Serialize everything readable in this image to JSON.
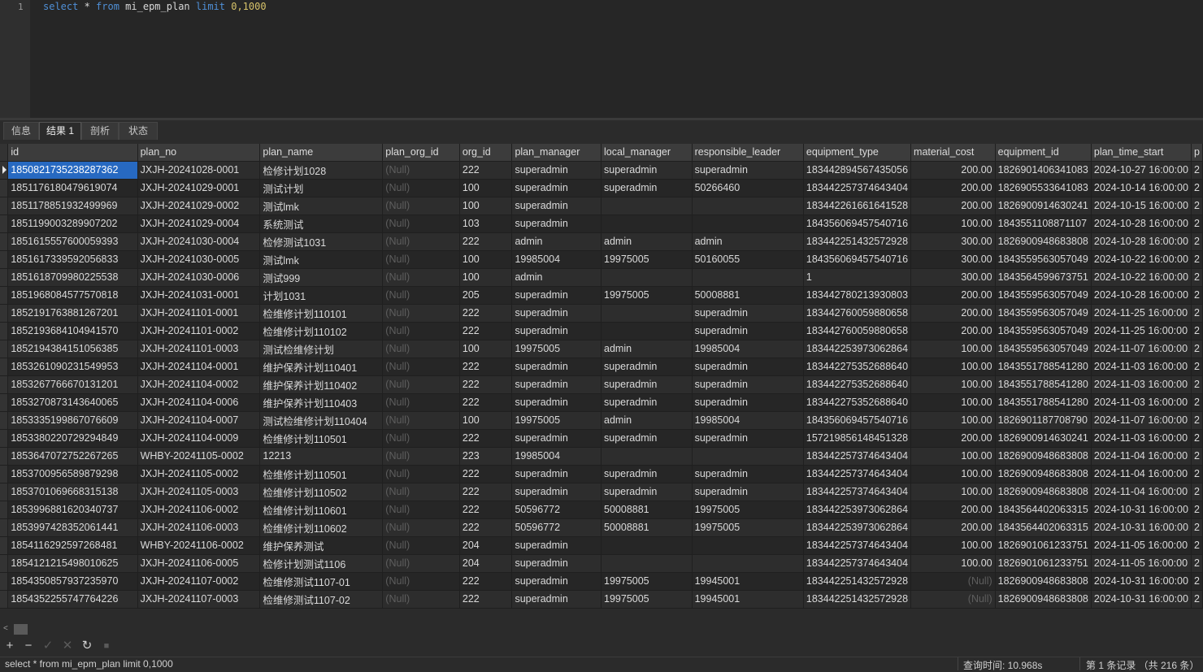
{
  "editor": {
    "line_number": "1",
    "tokens": {
      "select": "select",
      "star": " * ",
      "from": "from",
      "table": " mi_epm_plan ",
      "limit": "limit",
      "range": " 0,1000"
    }
  },
  "tabs": [
    {
      "label": "信息"
    },
    {
      "label": "结果 1"
    },
    {
      "label": "剖析"
    },
    {
      "label": "状态"
    }
  ],
  "grid": {
    "columns": [
      "id",
      "plan_no",
      "plan_name",
      "plan_org_id",
      "org_id",
      "plan_manager",
      "local_manager",
      "responsible_leader",
      "equipment_type",
      "material_cost",
      "equipment_id",
      "plan_time_start",
      "p"
    ],
    "rows": [
      [
        "1850821735238287362",
        "JXJH-20241028-0001",
        "检修计划1028",
        "(Null)",
        "222",
        "superadmin",
        "superadmin",
        "superadmin",
        "183442894567435056",
        "200.00",
        "1826901406341083",
        "2024-10-27 16:00:00",
        "2"
      ],
      [
        "1851176180479619074",
        "JXJH-20241029-0001",
        "测试计划",
        "(Null)",
        "100",
        "superadmin",
        "superadmin",
        "50266460",
        "183442257374643404",
        "200.00",
        "1826905533641083",
        "2024-10-14 16:00:00",
        "2"
      ],
      [
        "1851178851932499969",
        "JXJH-20241029-0002",
        "测试lmk",
        "(Null)",
        "100",
        "superadmin",
        "",
        "",
        "183442261661641528",
        "200.00",
        "1826900914630241",
        "2024-10-15 16:00:00",
        "2"
      ],
      [
        "1851199003289907202",
        "JXJH-20241029-0004",
        "系统测试",
        "(Null)",
        "103",
        "superadmin",
        "",
        "",
        "184356069457540716",
        "100.00",
        "1843551108871107",
        "2024-10-28 16:00:00",
        "2"
      ],
      [
        "1851615557600059393",
        "JXJH-20241030-0004",
        "检修测试1031",
        "(Null)",
        "222",
        "admin",
        "admin",
        "admin",
        "183442251432572928",
        "300.00",
        "1826900948683808",
        "2024-10-28 16:00:00",
        "2"
      ],
      [
        "1851617339592056833",
        "JXJH-20241030-0005",
        "测试lmk",
        "(Null)",
        "100",
        "19985004",
        "19975005",
        "50160055",
        "184356069457540716",
        "300.00",
        "1843559563057049",
        "2024-10-22 16:00:00",
        "2"
      ],
      [
        "1851618709980225538",
        "JXJH-20241030-0006",
        "测试999",
        "(Null)",
        "100",
        "admin",
        "",
        "",
        "1",
        "300.00",
        "1843564599673751",
        "2024-10-22 16:00:00",
        "2"
      ],
      [
        "1851968084577570818",
        "JXJH-20241031-0001",
        "计划1031",
        "(Null)",
        "205",
        "superadmin",
        "19975005",
        "50008881",
        "183442780213930803",
        "200.00",
        "1843559563057049",
        "2024-10-28 16:00:00",
        "2"
      ],
      [
        "1852191763881267201",
        "JXJH-20241101-0001",
        "检维修计划110101",
        "(Null)",
        "222",
        "superadmin",
        "",
        "superadmin",
        "183442760059880658",
        "200.00",
        "1843559563057049",
        "2024-11-25 16:00:00",
        "2"
      ],
      [
        "1852193684104941570",
        "JXJH-20241101-0002",
        "检维修计划110102",
        "(Null)",
        "222",
        "superadmin",
        "",
        "superadmin",
        "183442760059880658",
        "200.00",
        "1843559563057049",
        "2024-11-25 16:00:00",
        "2"
      ],
      [
        "1852194384151056385",
        "JXJH-20241101-0003",
        "测试检维修计划",
        "(Null)",
        "100",
        "19975005",
        "admin",
        "19985004",
        "183442253973062864",
        "100.00",
        "1843559563057049",
        "2024-11-07 16:00:00",
        "2"
      ],
      [
        "1853261090231549953",
        "JXJH-20241104-0001",
        "维护保养计划110401",
        "(Null)",
        "222",
        "superadmin",
        "superadmin",
        "superadmin",
        "183442275352688640",
        "100.00",
        "1843551788541280",
        "2024-11-03 16:00:00",
        "2"
      ],
      [
        "1853267766670131201",
        "JXJH-20241104-0002",
        "维护保养计划110402",
        "(Null)",
        "222",
        "superadmin",
        "superadmin",
        "superadmin",
        "183442275352688640",
        "100.00",
        "1843551788541280",
        "2024-11-03 16:00:00",
        "2"
      ],
      [
        "1853270873143640065",
        "JXJH-20241104-0006",
        "维护保养计划110403",
        "(Null)",
        "222",
        "superadmin",
        "superadmin",
        "superadmin",
        "183442275352688640",
        "100.00",
        "1843551788541280",
        "2024-11-03 16:00:00",
        "2"
      ],
      [
        "1853335199867076609",
        "JXJH-20241104-0007",
        "测试检维修计划110404",
        "(Null)",
        "100",
        "19975005",
        "admin",
        "19985004",
        "184356069457540716",
        "100.00",
        "1826901187708790",
        "2024-11-07 16:00:00",
        "2"
      ],
      [
        "1853380220729294849",
        "JXJH-20241104-0009",
        "检维修计划110501",
        "(Null)",
        "222",
        "superadmin",
        "superadmin",
        "superadmin",
        "157219856148451328",
        "200.00",
        "1826900914630241",
        "2024-11-03 16:00:00",
        "2"
      ],
      [
        "1853647072752267265",
        "WHBY-20241105-0002",
        "12213",
        "(Null)",
        "223",
        "19985004",
        "",
        "",
        "183442257374643404",
        "100.00",
        "1826900948683808",
        "2024-11-04 16:00:00",
        "2"
      ],
      [
        "1853700956589879298",
        "JXJH-20241105-0002",
        "检维修计划110501",
        "(Null)",
        "222",
        "superadmin",
        "superadmin",
        "superadmin",
        "183442257374643404",
        "100.00",
        "1826900948683808",
        "2024-11-04 16:00:00",
        "2"
      ],
      [
        "1853701069668315138",
        "JXJH-20241105-0003",
        "检维修计划110502",
        "(Null)",
        "222",
        "superadmin",
        "superadmin",
        "superadmin",
        "183442257374643404",
        "100.00",
        "1826900948683808",
        "2024-11-04 16:00:00",
        "2"
      ],
      [
        "1853996881620340737",
        "JXJH-20241106-0002",
        "检维修计划110601",
        "(Null)",
        "222",
        "50596772",
        "50008881",
        "19975005",
        "183442253973062864",
        "200.00",
        "1843564402063315",
        "2024-10-31 16:00:00",
        "2"
      ],
      [
        "1853997428352061441",
        "JXJH-20241106-0003",
        "检维修计划110602",
        "(Null)",
        "222",
        "50596772",
        "50008881",
        "19975005",
        "183442253973062864",
        "200.00",
        "1843564402063315",
        "2024-10-31 16:00:00",
        "2"
      ],
      [
        "1854116292597268481",
        "WHBY-20241106-0002",
        "维护保养测试",
        "(Null)",
        "204",
        "superadmin",
        "",
        "",
        "183442257374643404",
        "100.00",
        "1826901061233751",
        "2024-11-05 16:00:00",
        "2"
      ],
      [
        "1854121215498010625",
        "JXJH-20241106-0005",
        "检修计划测试1106",
        "(Null)",
        "204",
        "superadmin",
        "",
        "",
        "183442257374643404",
        "100.00",
        "1826901061233751",
        "2024-11-05 16:00:00",
        "2"
      ],
      [
        "1854350857937235970",
        "JXJH-20241107-0002",
        "检维修测试1107-01",
        "(Null)",
        "222",
        "superadmin",
        "19975005",
        "19945001",
        "183442251432572928",
        "(Null)",
        "1826900948683808",
        "2024-10-31 16:00:00",
        "2"
      ],
      [
        "1854352255747764226",
        "JXJH-20241107-0003",
        "检维修测试1107-02",
        "(Null)",
        "222",
        "superadmin",
        "19975005",
        "19945001",
        "183442251432572928",
        "(Null)",
        "1826900948683808",
        "2024-10-31 16:00:00",
        "2"
      ]
    ]
  },
  "hscroll": {
    "left_arrow": "<"
  },
  "toolbar": {
    "add": "+",
    "remove": "−",
    "apply": "✓",
    "discard": "✕",
    "refresh": "↻",
    "stop": "■"
  },
  "status": {
    "sql": "select * from mi_epm_plan limit 0,1000",
    "query_time": "查询时间: 10.968s",
    "record_info": "第 1 条记录 （共 216 条）"
  },
  "colors": {
    "selection": "#2769c1",
    "keyword": "#4f8fd6",
    "number": "#d7c36a",
    "null_text": "#5e5e5e"
  }
}
